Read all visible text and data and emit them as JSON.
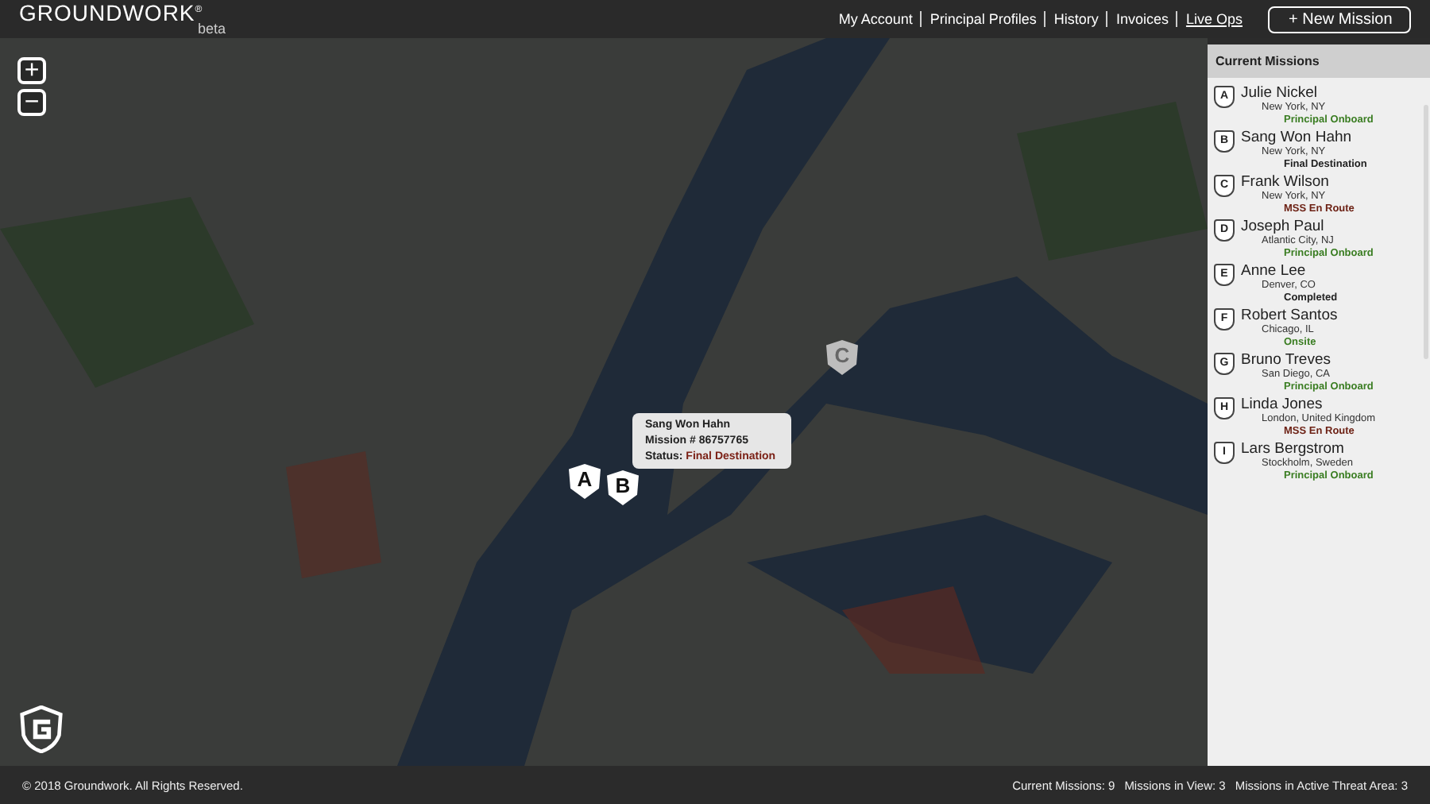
{
  "header": {
    "logo": "GROUNDWORK",
    "logo_mark": "®",
    "logo_sub": "beta",
    "nav": [
      {
        "label": "My Account",
        "selected": false
      },
      {
        "label": "Principal Profiles",
        "selected": false
      },
      {
        "label": "History",
        "selected": false
      },
      {
        "label": "Invoices",
        "selected": false
      },
      {
        "label": "Live Ops",
        "selected": true
      }
    ],
    "new_button": "+ New Mission"
  },
  "map": {
    "zoom_in": "+",
    "zoom_out": "−",
    "markers": [
      {
        "letter": "A",
        "dimmed": false
      },
      {
        "letter": "B",
        "dimmed": false
      },
      {
        "letter": "C",
        "dimmed": true
      }
    ],
    "tooltip": {
      "name": "Sang Won Hahn",
      "mission": "Mission # 86757765",
      "status_label": "Status:",
      "status": "Final Destination"
    }
  },
  "sidebar": {
    "title": "Current Missions",
    "missions": [
      {
        "letter": "A",
        "name": "Julie Nickel",
        "location": "New York, NY",
        "status": "Principal Onboard",
        "color": "#3a7d22"
      },
      {
        "letter": "B",
        "name": "Sang Won Hahn",
        "location": "New York, NY",
        "status": "Final Destination",
        "color": "#222222"
      },
      {
        "letter": "C",
        "name": "Frank Wilson",
        "location": "New York, NY",
        "status": "MSS En Route",
        "color": "#6b1f12"
      },
      {
        "letter": "D",
        "name": "Joseph Paul",
        "location": "Atlantic City, NJ",
        "status": "Principal Onboard",
        "color": "#3a7d22"
      },
      {
        "letter": "E",
        "name": "Anne Lee",
        "location": "Denver, CO",
        "status": "Completed",
        "color": "#222222"
      },
      {
        "letter": "F",
        "name": "Robert Santos",
        "location": "Chicago, IL",
        "status": "Onsite",
        "color": "#3a7d22"
      },
      {
        "letter": "G",
        "name": "Bruno Treves",
        "location": "San Diego, CA",
        "status": "Principal Onboard",
        "color": "#3a7d22"
      },
      {
        "letter": "H",
        "name": "Linda Jones",
        "location": "London, United Kingdom",
        "status": "MSS En Route",
        "color": "#6b1f12"
      },
      {
        "letter": "I",
        "name": "Lars Bergstrom",
        "location": "Stockholm, Sweden",
        "status": "Principal Onboard",
        "color": "#3a7d22"
      }
    ]
  },
  "footer": {
    "copyright": "© 2018 Groundwork. All Rights Reserved.",
    "stats": [
      "Current Missions: 9",
      "Missions in View: 3",
      "Missions in Active Threat Area:  3"
    ]
  }
}
